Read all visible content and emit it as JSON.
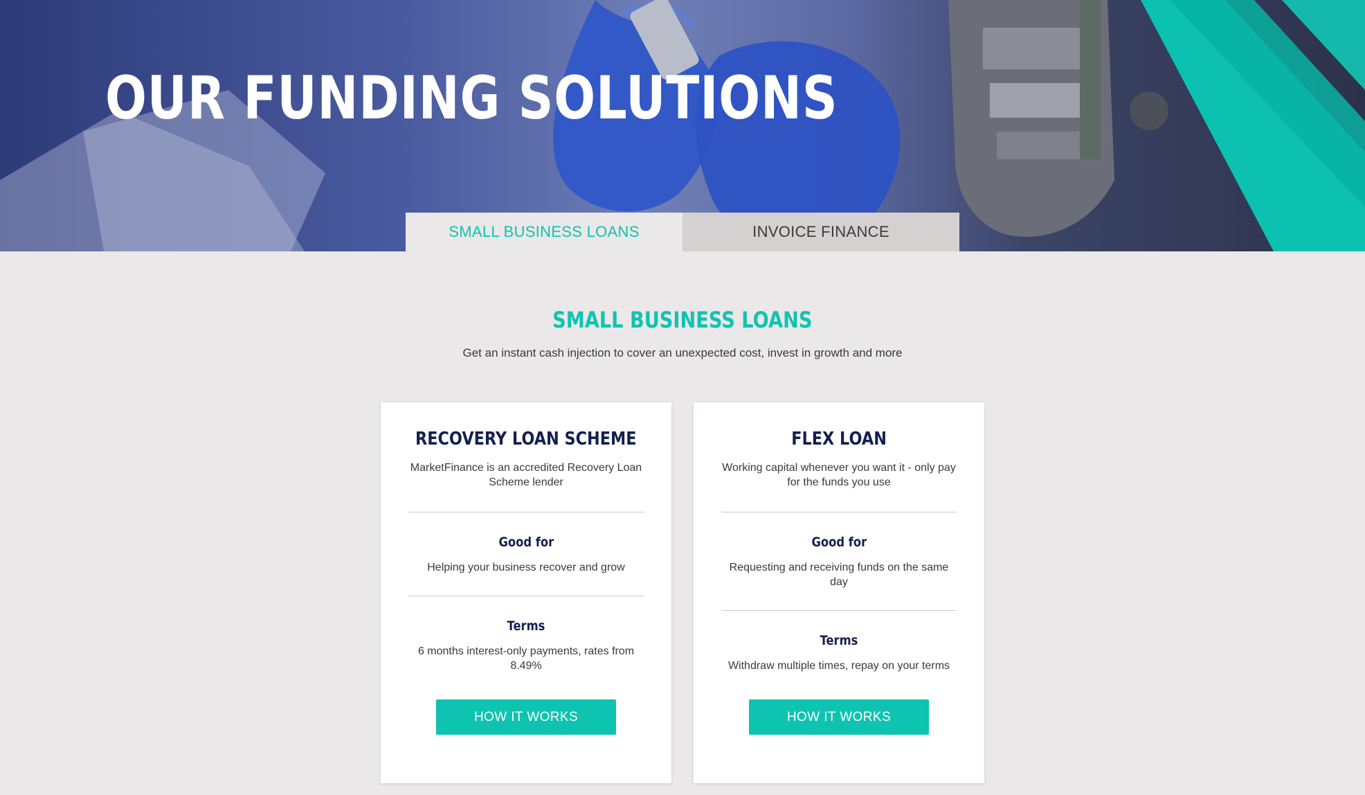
{
  "hero": {
    "title": "OUR FUNDING SOLUTIONS"
  },
  "tabs": [
    {
      "label": "SMALL BUSINESS LOANS",
      "active": true
    },
    {
      "label": "INVOICE FINANCE",
      "active": false
    }
  ],
  "section": {
    "title": "SMALL BUSINESS LOANS",
    "subtitle": "Get an instant cash injection to cover an unexpected cost, invest in growth and more"
  },
  "cards": [
    {
      "title": "RECOVERY LOAN SCHEME",
      "description": "MarketFinance is an accredited Recovery Loan Scheme lender",
      "good_for_heading": "Good for",
      "good_for_text": "Helping your business recover and grow",
      "terms_heading": "Terms",
      "terms_text": "6 months interest-only payments, rates from 8.49%",
      "button_label": "HOW IT WORKS"
    },
    {
      "title": "FLEX LOAN",
      "description": "Working capital whenever you want it - only pay for the funds you use",
      "good_for_heading": "Good for",
      "good_for_text": "Requesting and receiving funds on the same day",
      "terms_heading": "Terms",
      "terms_text": "Withdraw multiple times, repay on your terms",
      "button_label": "HOW IT WORKS"
    }
  ],
  "colors": {
    "accent": "#0fc3b1",
    "navy": "#14204f",
    "page_bg": "#eae8e8",
    "inactive_tab": "#d6d1d1"
  }
}
